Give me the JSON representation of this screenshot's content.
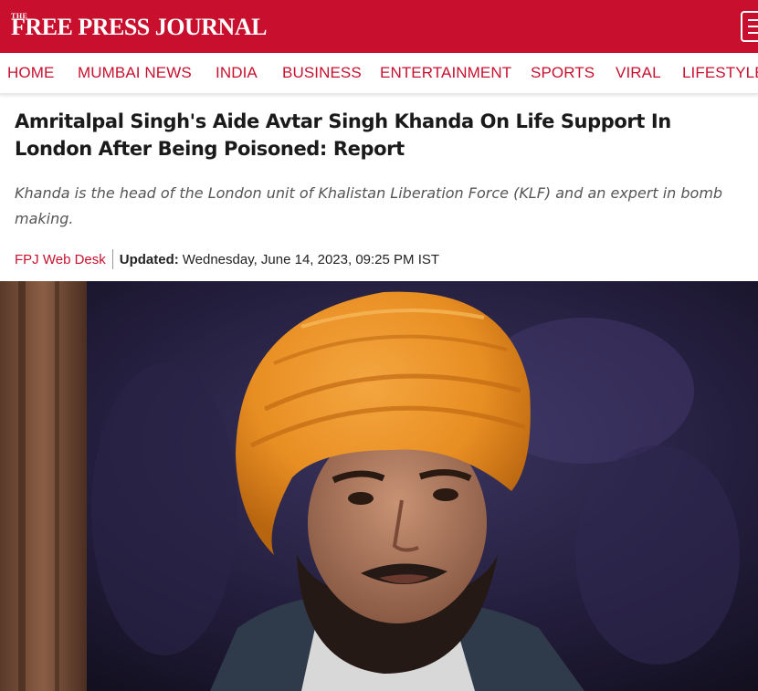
{
  "site": {
    "logo_small": "THE",
    "logo_main": "FREE PRESS JOURNAL",
    "brand_color": "#c8102e",
    "menu_icon": "hamburger-menu-icon"
  },
  "nav": {
    "items": [
      "HOME",
      "MUMBAI NEWS",
      "INDIA",
      "BUSINESS",
      "ENTERTAINMENT",
      "SPORTS",
      "VIRAL",
      "LIFESTYLE"
    ]
  },
  "article": {
    "headline": "Amritalpal Singh's Aide Avtar Singh Khanda On Life Support In London After Being Poisoned: Report",
    "summary": "Khanda is the head of the London unit of Khalistan Liberation Force (KLF) and an expert in bomb making.",
    "author": "FPJ Web Desk",
    "updated_label": "Updated:",
    "updated_value": "Wednesday, June 14, 2023, 09:25 PM IST"
  },
  "hero_image": {
    "subject": "man-in-orange-turban-photo"
  }
}
